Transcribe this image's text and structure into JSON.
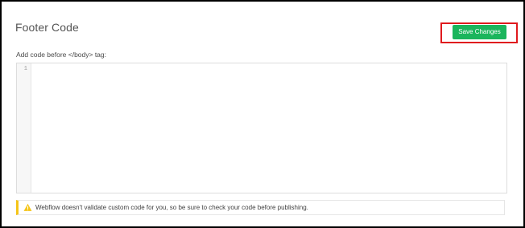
{
  "section": {
    "title": "Footer Code",
    "save_label": "Save Changes",
    "field_label": "Add code before </body> tag:"
  },
  "editor": {
    "line_numbers": [
      "1"
    ],
    "content": ""
  },
  "warning": {
    "icon": "warning-icon",
    "text": "Webflow doesn't validate custom code for you, so be sure to check your code before publishing."
  },
  "colors": {
    "save_button": "#1bb55c",
    "highlight_box": "#e0191e",
    "warning_accent": "#f5c518"
  }
}
